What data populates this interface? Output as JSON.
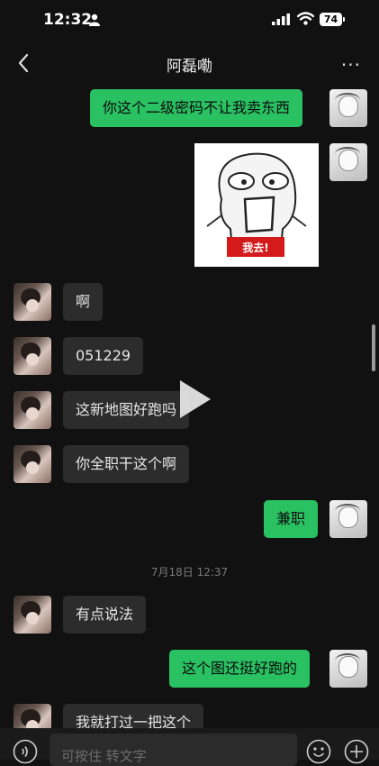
{
  "status_bar": {
    "time": "12:32",
    "battery": "74"
  },
  "header": {
    "title": "阿磊嘞",
    "more": "···"
  },
  "messages": [
    {
      "side": "out",
      "text": "你这个二级密码不让我卖东西"
    },
    {
      "side": "out",
      "type": "sticker",
      "sticker_text": "我去!"
    },
    {
      "side": "in",
      "text": "啊"
    },
    {
      "side": "in",
      "text": "051229"
    },
    {
      "side": "in",
      "text": "这新地图好跑吗"
    },
    {
      "side": "in",
      "text": "你全职干这个啊"
    },
    {
      "side": "out",
      "text": "兼职"
    },
    {
      "type": "timestamp",
      "text": "7月18日 12:37"
    },
    {
      "side": "in",
      "text": "有点说法"
    },
    {
      "side": "out",
      "text": "这个图还挺好跑的"
    },
    {
      "side": "in",
      "text": "我就打过一把这个"
    }
  ],
  "input_bar": {
    "placeholder": "可按住 转文字"
  },
  "colors": {
    "outgoing_bubble": "#2ac163",
    "incoming_bubble": "#2c2c2c",
    "background": "#111111"
  }
}
